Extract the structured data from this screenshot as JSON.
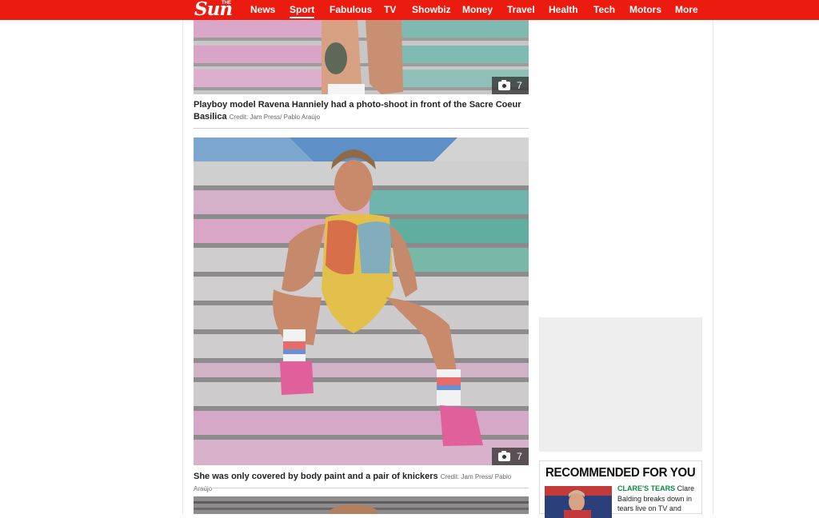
{
  "brand": {
    "logo_text": "Sun",
    "logo_small": "THE"
  },
  "nav": {
    "items": [
      {
        "label": "News"
      },
      {
        "label": "Sport"
      },
      {
        "label": "Fabulous"
      },
      {
        "label": "TV"
      },
      {
        "label": "Showbiz"
      },
      {
        "label": "Money"
      },
      {
        "label": "Travel"
      },
      {
        "label": "Health"
      },
      {
        "label": "Tech"
      },
      {
        "label": "Motors"
      },
      {
        "label": "More"
      }
    ],
    "active": "Sport"
  },
  "gallery": [
    {
      "photo_count": "7",
      "caption": "Playboy model Ravena Hanniely had a photo-shoot in front of the Sacre Coeur Basilica",
      "credit": "Credit: Jam Press/ Pablo Araújo"
    },
    {
      "photo_count": "7",
      "caption": "She was only covered by body paint and a pair of knickers",
      "credit": "Credit: Jam Press/ Pablo Araújo"
    }
  ],
  "sidebar": {
    "recommended_title": "RECOMMENDED FOR YOU",
    "story": {
      "kicker": "CLARE'S TEARS",
      "headline": "Clare Balding breaks down in tears live on TV and"
    }
  },
  "colors": {
    "brand_red": "#eb1c0f",
    "kicker_green": "#138a3c"
  },
  "icons": [
    "camera-icon"
  ]
}
